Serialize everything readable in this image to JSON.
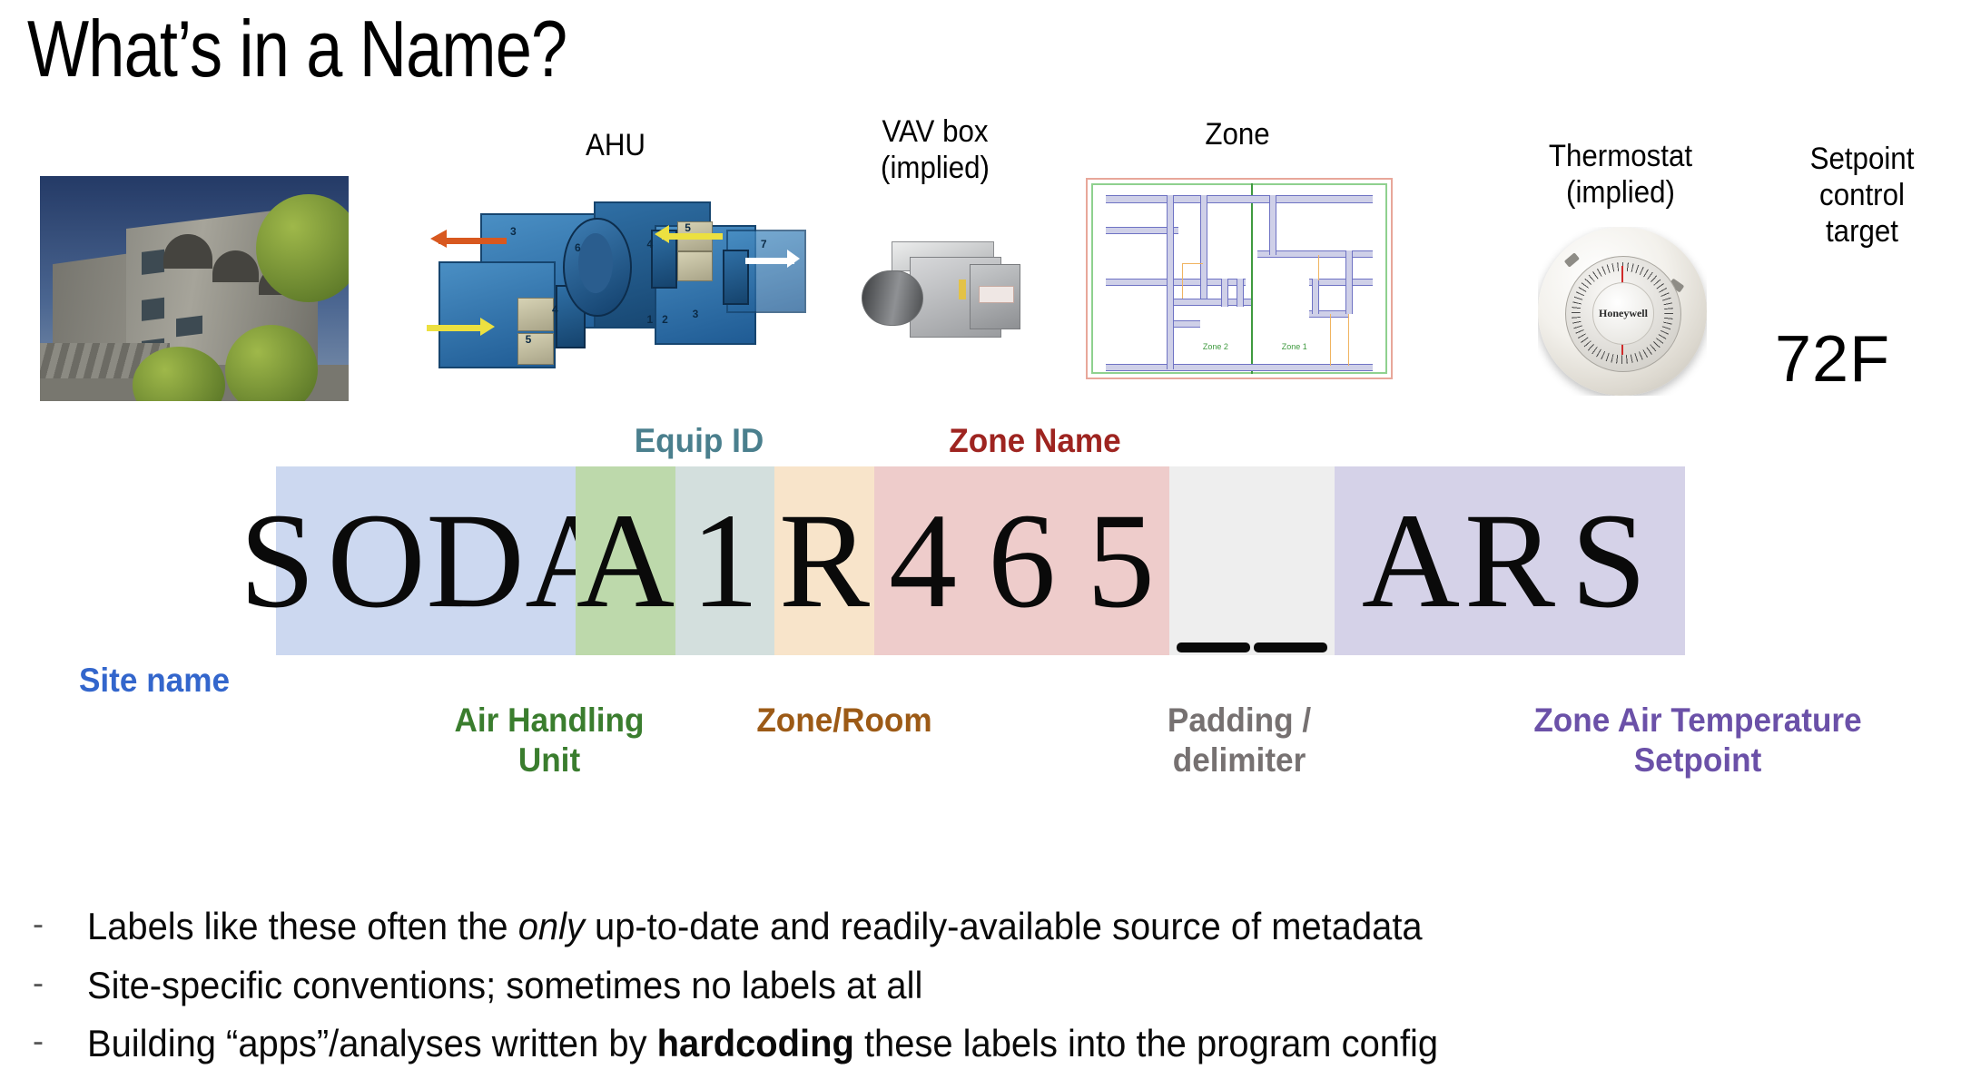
{
  "title": "What’s in a Name?",
  "captions": [
    {
      "name": "ahu",
      "lines": [
        "AHU"
      ]
    },
    {
      "name": "vav",
      "lines": [
        "VAV box",
        "(implied)"
      ]
    },
    {
      "name": "zone",
      "lines": [
        "Zone"
      ]
    },
    {
      "name": "thermostat",
      "lines": [
        "Thermostat",
        "(implied)"
      ]
    },
    {
      "name": "setpoint",
      "lines": [
        "Setpoint",
        "control",
        "target"
      ]
    }
  ],
  "setpoint_value": "72F",
  "thermostat_brand": "Honeywell",
  "zone_plan": {
    "zone_left_label": "Zone 2",
    "zone_right_label": "Zone 1"
  },
  "name_string": "SODA1R465__ARS",
  "segments": [
    {
      "id": "site",
      "text": "SODA",
      "color": "#ccd8f0"
    },
    {
      "id": "ahu",
      "text": "A",
      "color": "#bdd9ab"
    },
    {
      "id": "equip",
      "text": "1",
      "color": "#d3dfdd"
    },
    {
      "id": "room",
      "text": "R",
      "color": "#f8e4ca"
    },
    {
      "id": "zone",
      "text": "465",
      "color": "#eecccb"
    },
    {
      "id": "padding",
      "text": "",
      "color": "#eeeeee"
    },
    {
      "id": "zats",
      "text": "ARS",
      "color": "#d5d2e8"
    }
  ],
  "labels": {
    "equip_id": {
      "text": "Equip ID",
      "color": "#4a7f8d"
    },
    "zone_name": {
      "text": "Zone Name",
      "color": "#9e2420"
    },
    "site_name": {
      "text": "Site name",
      "color": "#3366cc"
    },
    "ahu": {
      "text": "Air Handling Unit",
      "color": "#3a7d2e"
    },
    "zone_room": {
      "text": "Zone/Room",
      "color": "#9c5a16"
    },
    "padding": {
      "text": "Padding / delimiter",
      "color": "#767171"
    },
    "zats": {
      "text": "Zone Air Temperature Setpoint",
      "color": "#6b51a8"
    }
  },
  "bullets": [
    {
      "dash": "-",
      "pre": "Labels like these often the ",
      "em": "only",
      "post": " up-to-date and readily-available source of metadata",
      "strong": ""
    },
    {
      "dash": "-",
      "pre": "Site-specific conventions; sometimes no labels at all",
      "em": "",
      "post": "",
      "strong": ""
    },
    {
      "dash": "-",
      "pre": "Building “apps”/analyses written by ",
      "em": "",
      "strong": "hardcoding",
      "post": " these labels into the program config"
    }
  ]
}
